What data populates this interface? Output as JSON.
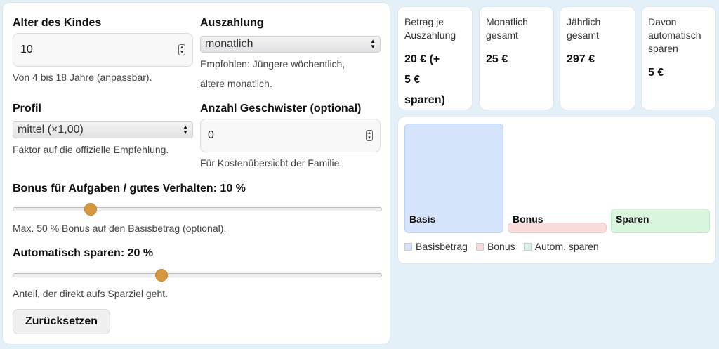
{
  "form": {
    "age": {
      "label": "Alter des Kindes",
      "value": "10",
      "hint": "Von 4 bis 18 Jahre (anpassbar)."
    },
    "payout": {
      "label": "Auszahlung",
      "selected": "monatlich",
      "hint_line1": "Empfohlen: Jüngere wöchentlich,",
      "hint_line2": "ältere monatlich."
    },
    "profile": {
      "label": "Profil",
      "selected": "mittel (×1,00)",
      "hint": "Faktor auf die offizielle Empfehlung."
    },
    "siblings": {
      "label": "Anzahl Geschwister (optional)",
      "value": "0",
      "hint": "Für Kostenübersicht der Familie."
    },
    "bonus": {
      "label": "Bonus für Aufgaben / gutes Verhalten: 10 %",
      "value_percent": 10,
      "max_percent": 50,
      "hint": "Max. 50 % Bonus auf den Basisbetrag (optional)."
    },
    "savings": {
      "label": "Automatisch sparen: 20 %",
      "value_percent": 20,
      "max_percent": 50,
      "hint": "Anteil, der direkt aufs Sparziel geht."
    },
    "reset_label": "Zurücksetzen"
  },
  "cards": [
    {
      "title": [
        "Betrag je",
        "Auszahlung"
      ],
      "value": [
        "20 € (+",
        "5 €",
        "sparen)"
      ]
    },
    {
      "title": [
        "Monatlich",
        "gesamt"
      ],
      "value": [
        "25 €"
      ]
    },
    {
      "title": [
        "Jährlich",
        "gesamt"
      ],
      "value": [
        "297 €"
      ]
    },
    {
      "title": [
        "Davon",
        "automatisch",
        "sparen"
      ],
      "value": [
        "5 €"
      ]
    }
  ],
  "chart": {
    "bars": [
      {
        "label": "Basis",
        "color": "#d6e4fb",
        "border": "#b9cff4"
      },
      {
        "label": "Bonus",
        "color": "#fbdcdc",
        "border": "#f2c4c4"
      },
      {
        "label": "Sparen",
        "color": "#daf5de",
        "border": "#bfe8c6"
      }
    ],
    "legend": [
      {
        "label": "Basisbetrag",
        "color": "#d6e4fb"
      },
      {
        "label": "Bonus",
        "color": "#fbdcdc"
      },
      {
        "label": "Autom. sparen",
        "color": "#daf5de"
      }
    ]
  }
}
